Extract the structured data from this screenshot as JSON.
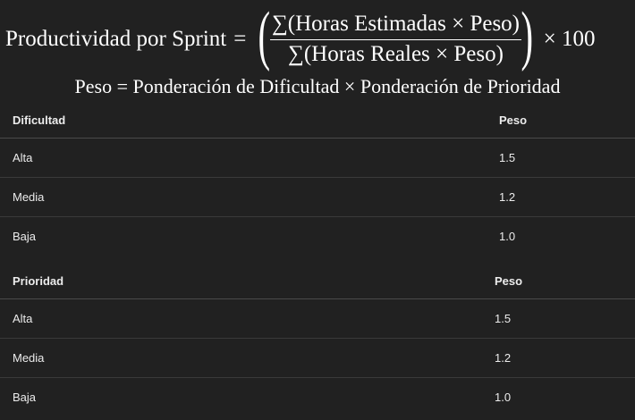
{
  "formula": {
    "lhs": "Productividad por Sprint",
    "equals": "=",
    "numerator": "∑(Horas Estimadas × Peso)",
    "denominator": "∑(Horas Reales × Peso)",
    "multiplier": "× 100",
    "weight_definition": "Peso = Ponderación de Dificultad × Ponderación de Prioridad"
  },
  "dificultad_table": {
    "headers": [
      "Dificultad",
      "Peso"
    ],
    "rows": [
      {
        "label": "Alta",
        "peso": "1.5"
      },
      {
        "label": "Media",
        "peso": "1.2"
      },
      {
        "label": "Baja",
        "peso": "1.0"
      }
    ]
  },
  "prioridad_table": {
    "headers": [
      "Prioridad",
      "Peso"
    ],
    "rows": [
      {
        "label": "Alta",
        "peso": "1.5"
      },
      {
        "label": "Media",
        "peso": "1.2"
      },
      {
        "label": "Baja",
        "peso": "1.0"
      }
    ]
  }
}
